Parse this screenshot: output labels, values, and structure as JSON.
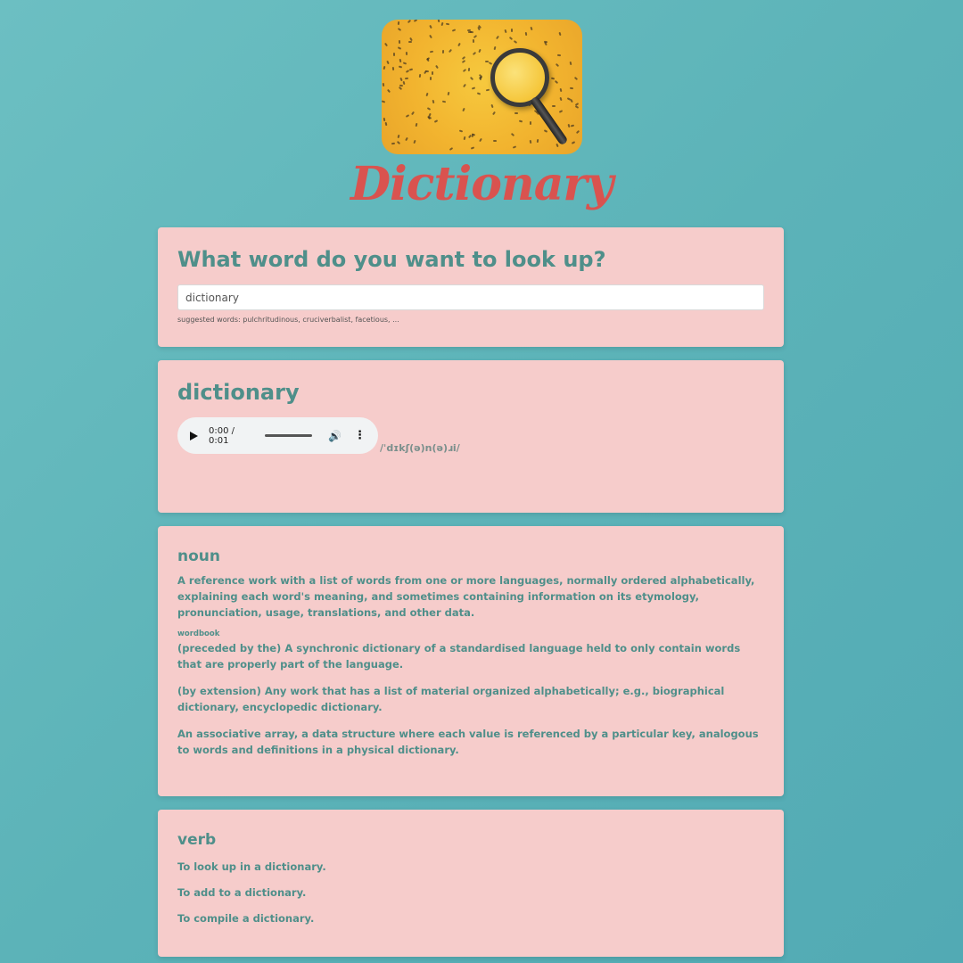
{
  "app": {
    "title": "Dictionary"
  },
  "search": {
    "heading": "What word do you want to look up?",
    "value": "dictionary",
    "suggestions": "suggested words: pulchritudinous, cruciverbalist, facetious, ..."
  },
  "word": {
    "text": "dictionary",
    "phonetic": "/ˈdɪkʃ(ə)n(ə)ɹi/",
    "audio": {
      "time": "0:00 / 0:01"
    }
  },
  "meanings": [
    {
      "part_of_speech": "noun",
      "definitions": [
        "A reference work with a list of words from one or more languages, normally ordered alphabetically, explaining each word's meaning, and sometimes containing information on its etymology, pronunciation, usage, translations, and other data.",
        "(preceded by the) A synchronic dictionary of a standardised language held to only contain words that are properly part of the language.",
        "(by extension) Any work that has a list of material organized alphabetically; e.g., biographical dictionary, encyclopedic dictionary.",
        "An associative array, a data structure where each value is referenced by a particular key, analogous to words and definitions in a physical dictionary."
      ],
      "synonym": "wordbook"
    },
    {
      "part_of_speech": "verb",
      "definitions": [
        "To look up in a dictionary.",
        "To add to a dictionary.",
        "To compile a dictionary."
      ]
    }
  ],
  "icons": {
    "logo": "magnifying-glass-over-letters",
    "play": "play-icon",
    "volume": "volume-icon",
    "more": "more-vertical-icon"
  },
  "colors": {
    "background": "#5cb3b8",
    "card": "#f6cccb",
    "title": "#d9534f",
    "text": "#4f8f8a"
  }
}
